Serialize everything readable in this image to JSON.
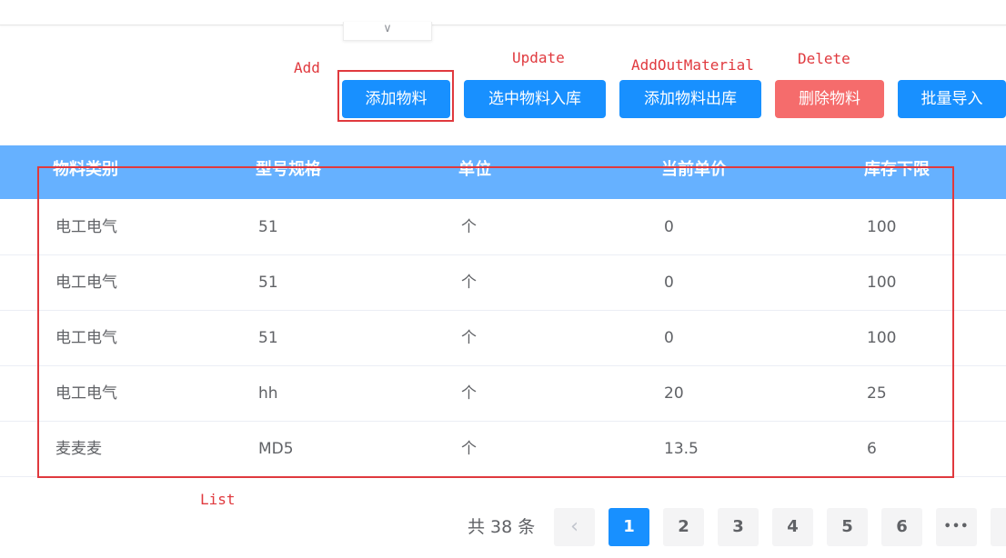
{
  "collapse_tab": {
    "icon": "chevron-down-icon",
    "glyph": "∨"
  },
  "annotations": {
    "add": "Add",
    "update": "Update",
    "add_out": "AddOutMaterial",
    "delete": "Delete",
    "list": "List"
  },
  "toolbar": {
    "add_label": "添加物料",
    "stock_in_label": "选中物料入库",
    "stock_out_label": "添加物料出库",
    "delete_label": "删除物料",
    "import_label": "批量导入"
  },
  "colors": {
    "primary": "#1890ff",
    "danger": "#f56c6c",
    "header": "#66b1ff",
    "annotation": "#e0393e"
  },
  "table": {
    "headers": [
      "物料类别",
      "型号规格",
      "单位",
      "当前单价",
      "库存下限"
    ],
    "rows": [
      [
        "电工电气",
        "51",
        "个",
        "0",
        "100"
      ],
      [
        "电工电气",
        "51",
        "个",
        "0",
        "100"
      ],
      [
        "电工电气",
        "51",
        "个",
        "0",
        "100"
      ],
      [
        "电工电气",
        "hh",
        "个",
        "20",
        "25"
      ],
      [
        "麦麦麦",
        "MD5",
        "个",
        "13.5",
        "6"
      ]
    ]
  },
  "pagination": {
    "total_text": "共 38 条",
    "prev_glyph": "‹",
    "pages": [
      "1",
      "2",
      "3",
      "4",
      "5",
      "6"
    ],
    "more_glyph": "•••",
    "current": "1"
  }
}
